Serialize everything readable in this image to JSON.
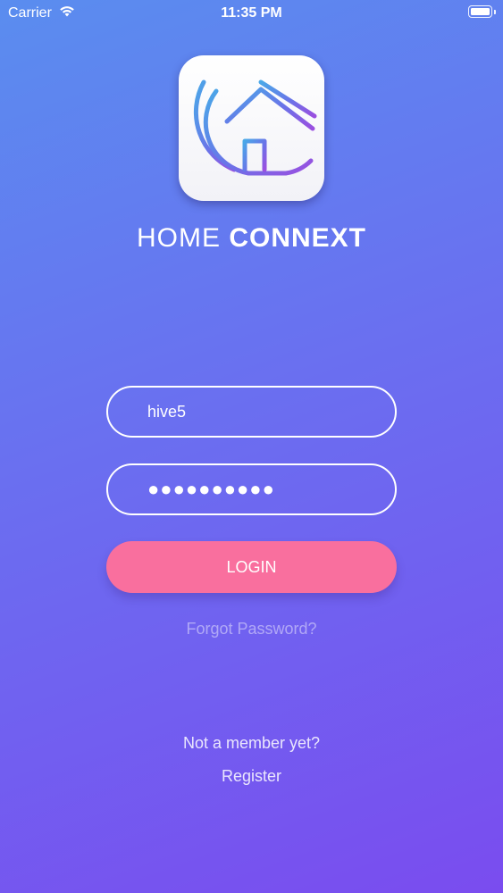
{
  "status_bar": {
    "carrier": "Carrier",
    "time": "11:35 PM",
    "icons": [
      "wifi-icon",
      "battery-icon"
    ]
  },
  "brand": {
    "name_light": "HOME",
    "name_bold": "CONNEXT",
    "logo_icon": "house-logo-icon"
  },
  "login_form": {
    "username_value": "hive5",
    "password_value": "●●●●●●●●●●",
    "login_label": "LOGIN",
    "forgot_label": "Forgot Password?"
  },
  "footer": {
    "not_member_text": "Not a member yet?",
    "register_label": "Register"
  },
  "colors": {
    "gradient_top": "#5a8def",
    "gradient_bottom": "#7a4cef",
    "login_button": "#f96f9e"
  }
}
